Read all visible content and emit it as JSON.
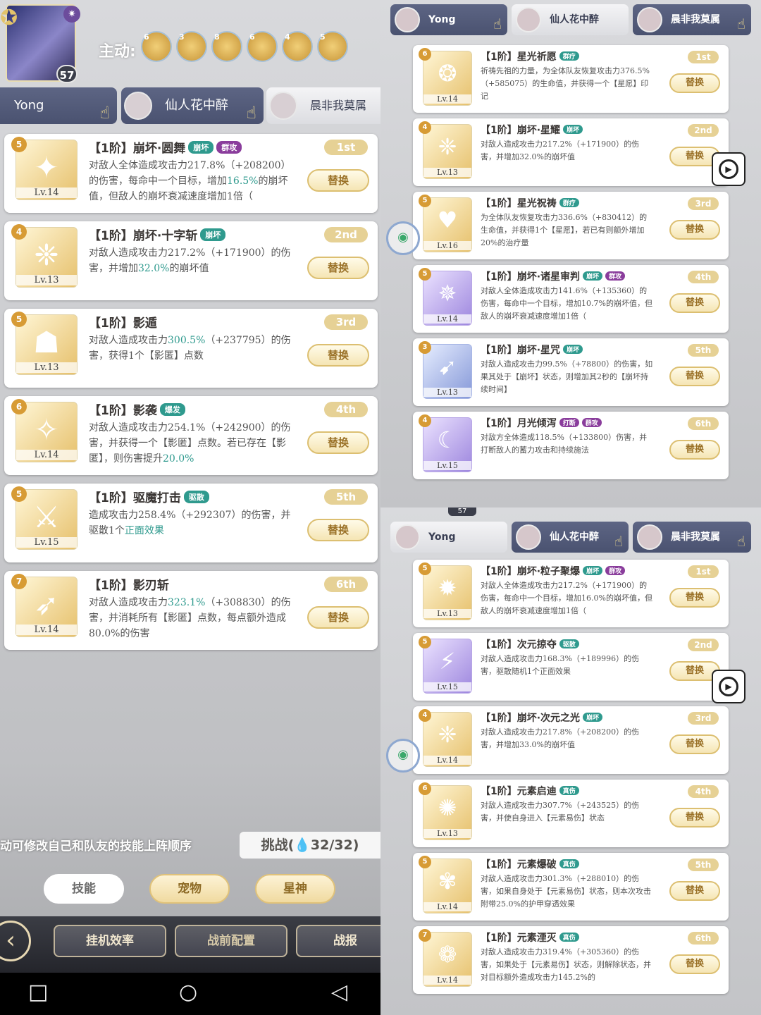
{
  "left": {
    "hero_level": "57",
    "active_label": "主动:",
    "active_slots": [
      "6",
      "3",
      "8",
      "6",
      "4",
      "5"
    ],
    "team_tabs": [
      "Yong",
      "仙人花中醉",
      "晨非我莫属"
    ],
    "cards": [
      {
        "num": "5",
        "level": "Lv.14",
        "title": "【1阶】崩坏·圆舞",
        "tag1": "崩坏",
        "tag2": "群攻",
        "rank": "1st",
        "swap": "替换",
        "desc_parts": [
          "对敌人全体造成攻击力217.8%（+208200）的伤害，每命中一个目标，增加",
          "16.5%",
          "的崩坏值，但敌人的崩坏衰减速度增加1倍（"
        ]
      },
      {
        "num": "4",
        "level": "Lv.13",
        "title": "【1阶】崩坏·十字斩",
        "tag1": "崩坏",
        "tag2": "",
        "rank": "2nd",
        "swap": "替换",
        "desc_parts": [
          "对敌人造成攻击力217.2%（+171900）的伤害，并增加",
          "32.0%",
          "的崩坏值"
        ]
      },
      {
        "num": "5",
        "level": "Lv.13",
        "title": "【1阶】影遁",
        "tag1": "",
        "tag2": "",
        "rank": "3rd",
        "swap": "替换",
        "desc_parts": [
          "对敌人造成攻击力",
          "300.5%",
          "（+237795）的伤害，获得1个【影匿】点数"
        ]
      },
      {
        "num": "6",
        "level": "Lv.14",
        "title": "【1阶】影袭",
        "tag1": "爆发",
        "tag2": "",
        "rank": "4th",
        "swap": "替换",
        "desc_parts": [
          "对敌人造成攻击力254.1%（+242900）的伤害，并获得一个【影匿】点数。若已存在【影匿】，则伤害提升",
          "20.0%",
          ""
        ]
      },
      {
        "num": "5",
        "level": "Lv.15",
        "title": "【1阶】驱魔打击",
        "tag1": "驱散",
        "tag2": "",
        "rank": "5th",
        "swap": "替换",
        "desc_parts": [
          "造成攻击力258.4%（+292307）的伤害，并驱散1个",
          "正面效果",
          ""
        ]
      },
      {
        "num": "7",
        "level": "Lv.14",
        "title": "【1阶】影刃斩",
        "tag1": "",
        "tag2": "",
        "rank": "6th",
        "swap": "替换",
        "desc_parts": [
          "对敌人造成攻击力",
          "323.1%",
          "（+308830）的伤害，并消耗所有【影匿】点数，每点额外造成80.0%的伤害"
        ]
      }
    ],
    "hint": "动可修改自己和队友的技能上阵顺序",
    "challenge": "挑战(💧32/32)",
    "categories": [
      "技能",
      "宠物",
      "星神"
    ],
    "bottom_buttons": [
      "挂机效率",
      "战前配置",
      "战报"
    ]
  },
  "top_right": {
    "team_tabs": [
      "Yong",
      "仙人花中醉",
      "晨非我莫属"
    ],
    "cards": [
      {
        "num": "6",
        "level": "Lv.14",
        "title": "【1阶】星光祈愿",
        "tag1": "群疗",
        "tag2": "",
        "rank": "1st",
        "swap": "替换",
        "desc": "祈祷先祖的力量，为全体队友恢复攻击力376.5%（+585075）的生命值，并获得一个【星愿】印记"
      },
      {
        "num": "4",
        "level": "Lv.13",
        "title": "【1阶】崩坏·星耀",
        "tag1": "崩坏",
        "tag2": "",
        "rank": "2nd",
        "swap": "替换",
        "desc": "对敌人造成攻击力217.2%（+171900）的伤害，并增加32.0%的崩坏值"
      },
      {
        "num": "5",
        "level": "Lv.16",
        "title": "【1阶】星光祝祷",
        "tag1": "群疗",
        "tag2": "",
        "rank": "3rd",
        "swap": "替换",
        "desc": "为全体队友恢复攻击力336.6%（+830412）的生命值，并获得1个【星愿】，若已有则额外增加20%的治疗量"
      },
      {
        "num": "5",
        "level": "Lv.14",
        "title": "【1阶】崩坏·诸星审判",
        "tag1": "崩坏",
        "tag2": "群攻",
        "rank": "4th",
        "swap": "替换",
        "desc": "对敌人全体造成攻击力141.6%（+135360）的伤害，每命中一个目标，增加10.7%的崩坏值，但敌人的崩坏衰减速度增加1倍（"
      },
      {
        "num": "3",
        "level": "Lv.13",
        "title": "【1阶】崩坏·星咒",
        "tag1": "崩坏",
        "tag2": "",
        "rank": "5th",
        "swap": "替换",
        "desc": "对敌人造成攻击力99.5%（+78800）的伤害，如果其处于【崩坏】状态，则增加其2秒的【崩坏持续时间】"
      },
      {
        "num": "4",
        "level": "Lv.15",
        "title": "【1阶】月光倾泻",
        "tag1": "打断",
        "tag2": "群攻",
        "rank": "6th",
        "swap": "替换",
        "desc": "对敌方全体造成118.5%（+133800）伤害，并打断敌人的蓄力攻击和持续施法"
      }
    ]
  },
  "bottom_right": {
    "hero_level": "57",
    "team_tabs": [
      "Yong",
      "仙人花中醉",
      "晨非我莫属"
    ],
    "cards": [
      {
        "num": "5",
        "level": "Lv.13",
        "title": "【1阶】崩坏·粒子聚爆",
        "tag1": "崩坏",
        "tag2": "群攻",
        "rank": "1st",
        "swap": "替换",
        "desc": "对敌人全体造成攻击力217.2%（+171900）的伤害，每命中一个目标，增加16.0%的崩坏值，但敌人的崩坏衰减速度增加1倍（"
      },
      {
        "num": "5",
        "level": "Lv.15",
        "title": "【1阶】次元掠夺",
        "tag1": "驱散",
        "tag2": "",
        "rank": "2nd",
        "swap": "替换",
        "desc": "对敌人造成攻击力168.3%（+189996）的伤害，驱散随机1个正面效果"
      },
      {
        "num": "4",
        "level": "Lv.14",
        "title": "【1阶】崩坏·次元之光",
        "tag1": "崩坏",
        "tag2": "",
        "rank": "3rd",
        "swap": "替换",
        "desc": "对敌人造成攻击力217.8%（+208200）的伤害，并增加33.0%的崩坏值"
      },
      {
        "num": "6",
        "level": "Lv.13",
        "title": "【1阶】元素启迪",
        "tag1": "真伤",
        "tag2": "",
        "rank": "4th",
        "swap": "替换",
        "desc": "对敌人造成攻击力307.7%（+243525）的伤害，并使自身进入【元素易伤】状态"
      },
      {
        "num": "5",
        "level": "Lv.14",
        "title": "【1阶】元素爆破",
        "tag1": "真伤",
        "tag2": "",
        "rank": "5th",
        "swap": "替换",
        "desc": "对敌人造成攻击力301.3%（+288010）的伤害，如果自身处于【元素易伤】状态，则本次攻击附带25.0%的护甲穿透效果"
      },
      {
        "num": "7",
        "level": "Lv.14",
        "title": "【1阶】元素湮灭",
        "tag1": "真伤",
        "tag2": "",
        "rank": "6th",
        "swap": "替换",
        "desc": "对敌人造成攻击力319.4%（+305360）的伤害，如果处于【元素易伤】状态，则解除状态，并对目标额外造成攻击力145.2%的"
      }
    ]
  }
}
